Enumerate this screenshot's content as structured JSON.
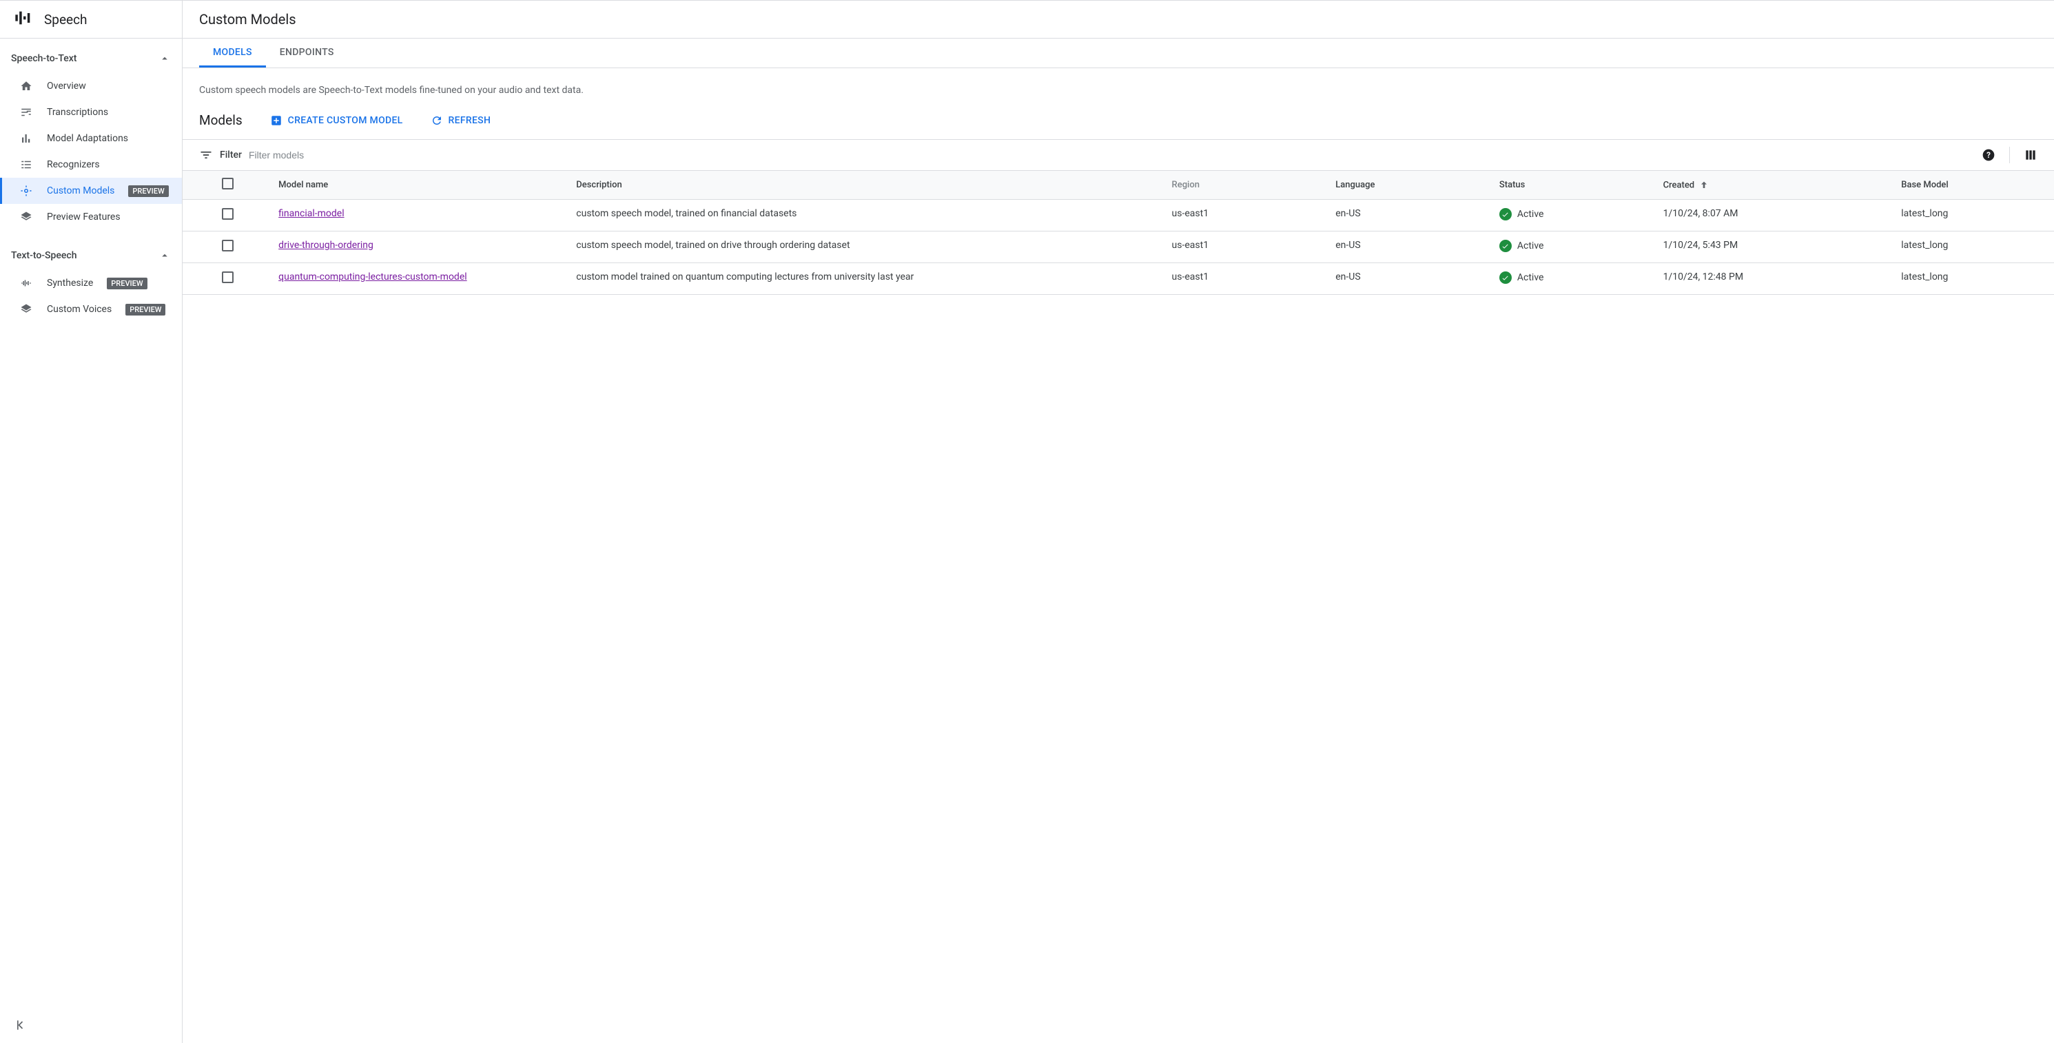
{
  "sidebar": {
    "title": "Speech",
    "sections": [
      {
        "label": "Speech-to-Text",
        "items": [
          {
            "label": "Overview",
            "icon": "home-icon"
          },
          {
            "label": "Transcriptions",
            "icon": "sliders-icon"
          },
          {
            "label": "Model Adaptations",
            "icon": "equalizer-icon"
          },
          {
            "label": "Recognizers",
            "icon": "list-icon"
          },
          {
            "label": "Custom Models",
            "icon": "tune-icon",
            "preview": true,
            "active": true
          },
          {
            "label": "Preview Features",
            "icon": "layers-icon"
          }
        ]
      },
      {
        "label": "Text-to-Speech",
        "items": [
          {
            "label": "Synthesize",
            "icon": "wave-icon",
            "preview": true
          },
          {
            "label": "Custom Voices",
            "icon": "layers-icon",
            "preview": true
          }
        ]
      }
    ],
    "preview_badge": "PREVIEW"
  },
  "header": {
    "title": "Custom Models"
  },
  "tabs": [
    {
      "label": "MODELS",
      "active": true
    },
    {
      "label": "ENDPOINTS"
    }
  ],
  "description": "Custom speech models are Speech-to-Text models fine-tuned on your audio and text data.",
  "toolbar": {
    "section_title": "Models",
    "create_label": "CREATE CUSTOM MODEL",
    "refresh_label": "REFRESH"
  },
  "filter": {
    "label": "Filter",
    "placeholder": "Filter models"
  },
  "table": {
    "columns": {
      "name": "Model name",
      "description": "Description",
      "region": "Region",
      "language": "Language",
      "status": "Status",
      "created": "Created",
      "base": "Base Model"
    },
    "rows": [
      {
        "name": "financial-model",
        "description": "custom speech model, trained on financial datasets",
        "region": "us-east1",
        "language": "en-US",
        "status": "Active",
        "created": "1/10/24, 8:07 AM",
        "base": "latest_long"
      },
      {
        "name": "drive-through-ordering",
        "description": "custom speech model, trained on drive through ordering dataset",
        "region": "us-east1",
        "language": "en-US",
        "status": "Active",
        "created": "1/10/24, 5:43 PM",
        "base": "latest_long"
      },
      {
        "name": "quantum-computing-lectures-custom-model",
        "description": "custom model trained on quantum computing lectures from university last year",
        "region": "us-east1",
        "language": "en-US",
        "status": "Active",
        "created": "1/10/24, 12:48 PM",
        "base": "latest_long"
      }
    ]
  }
}
